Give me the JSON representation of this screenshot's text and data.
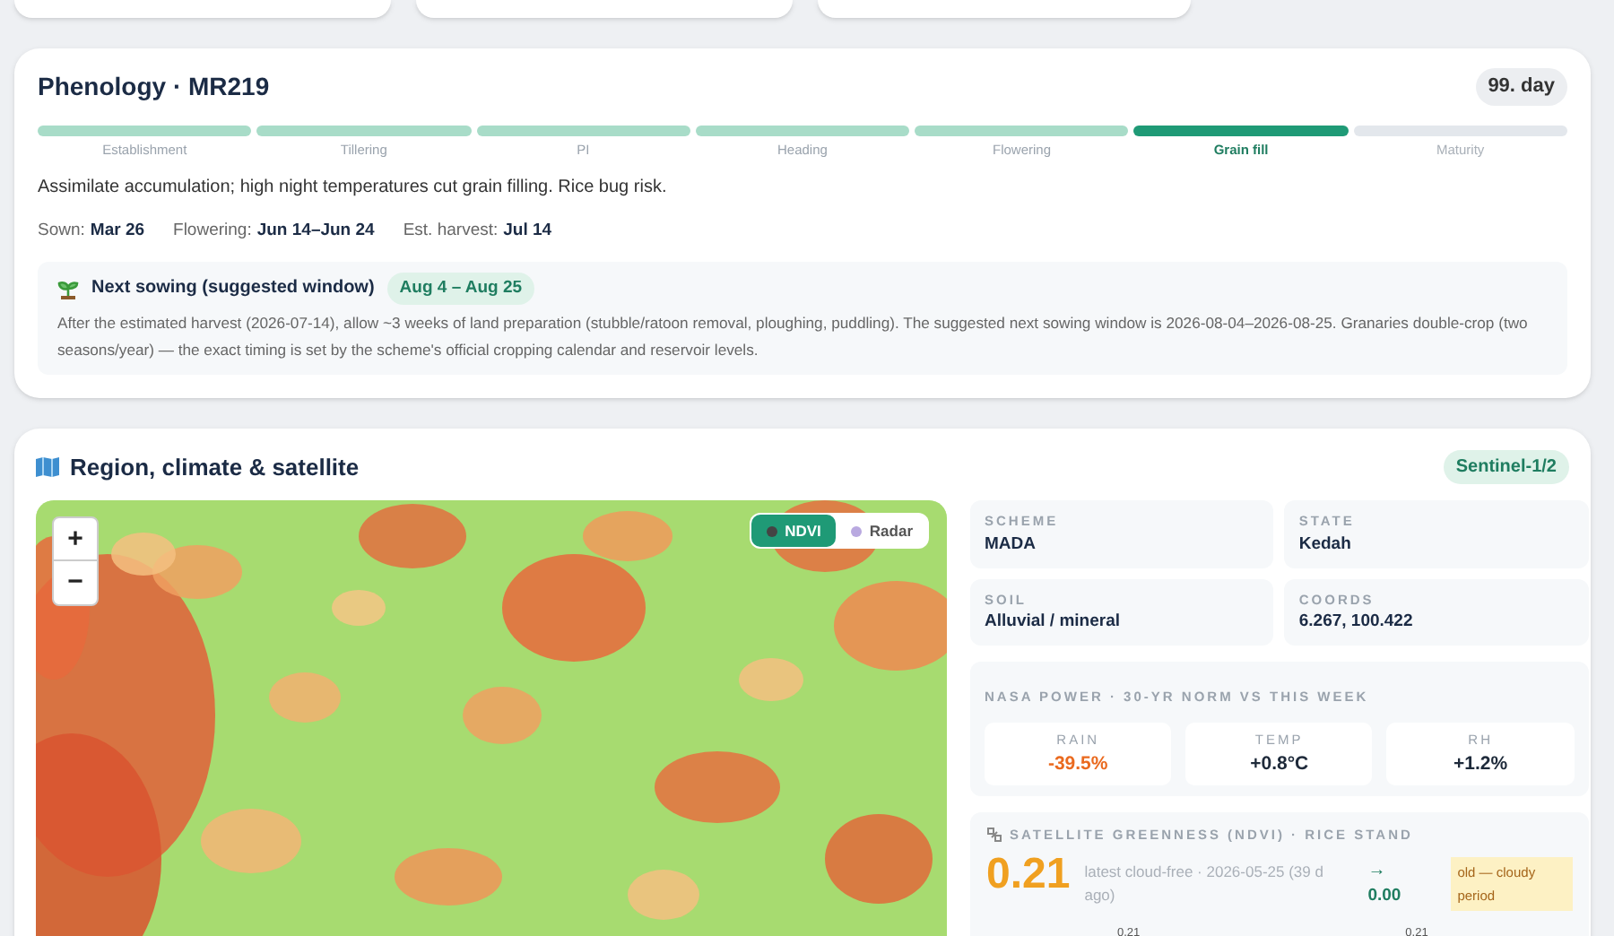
{
  "phenology": {
    "title": "Phenology · MR219",
    "day_badge": "99. day",
    "stages": [
      {
        "label": "Establishment",
        "completed": true,
        "selected": false
      },
      {
        "label": "Tillering",
        "completed": true,
        "selected": false
      },
      {
        "label": "PI",
        "completed": true,
        "selected": false
      },
      {
        "label": "Heading",
        "completed": true,
        "selected": false
      },
      {
        "label": "Flowering",
        "completed": true,
        "selected": false
      },
      {
        "label": "Grain fill",
        "completed": false,
        "selected": true
      },
      {
        "label": "Maturity",
        "completed": false,
        "selected": false
      }
    ],
    "description": "Assimilate accumulation; high night temperatures cut grain filling. Rice bug risk.",
    "dates": [
      {
        "label": "Sown:",
        "value": "Mar 26"
      },
      {
        "label": "Flowering:",
        "value": "Jun 14–Jun 24"
      },
      {
        "label": "Est. harvest:",
        "value": "Jul 14"
      }
    ],
    "next_sowing": {
      "title": "Next sowing (suggested window)",
      "window": "Aug 4 – Aug 25",
      "text": "After the estimated harvest (2026-07-14), allow ~3 weeks of land preparation (stubble/ratoon removal, ploughing, puddling). The suggested next sowing window is 2026-08-04–2026-08-25. Granaries double-crop (two seasons/year) — the exact timing is set by the scheme's official cropping calendar and reservoir levels."
    }
  },
  "region": {
    "title": "Region, climate & satellite",
    "source_badge": "Sentinel-1/2",
    "map": {
      "zoom_in": "+",
      "zoom_out": "−",
      "layers": [
        {
          "label": "NDVI",
          "selected": true
        },
        {
          "label": "Radar",
          "selected": false
        }
      ]
    },
    "facts": [
      {
        "label": "SCHEME",
        "value": "MADA"
      },
      {
        "label": "STATE",
        "value": "Kedah"
      },
      {
        "label": "SOIL",
        "value": "Alluvial / mineral"
      },
      {
        "label": "COORDS",
        "value": "6.267, 100.422"
      }
    ],
    "climate": {
      "title": "NASA POWER · 30-YR NORM VS THIS WEEK",
      "items": [
        {
          "label": "RAIN",
          "value": "-39.5%",
          "kind": "warning"
        },
        {
          "label": "TEMP",
          "value": "+0.8°C",
          "kind": "normal"
        },
        {
          "label": "RH",
          "value": "+1.2%",
          "kind": "normal"
        }
      ]
    },
    "ndvi": {
      "title": "SATELLITE GREENNESS (NDVI) · RICE STAND",
      "value": "0.21",
      "caption": "latest cloud-free · 2026-05-25 (39 d ago)",
      "trend_arrow": "→",
      "trend": "0.00",
      "note": "old — cloudy period",
      "chart_labels": [
        "0.21",
        "0.21"
      ]
    }
  }
}
